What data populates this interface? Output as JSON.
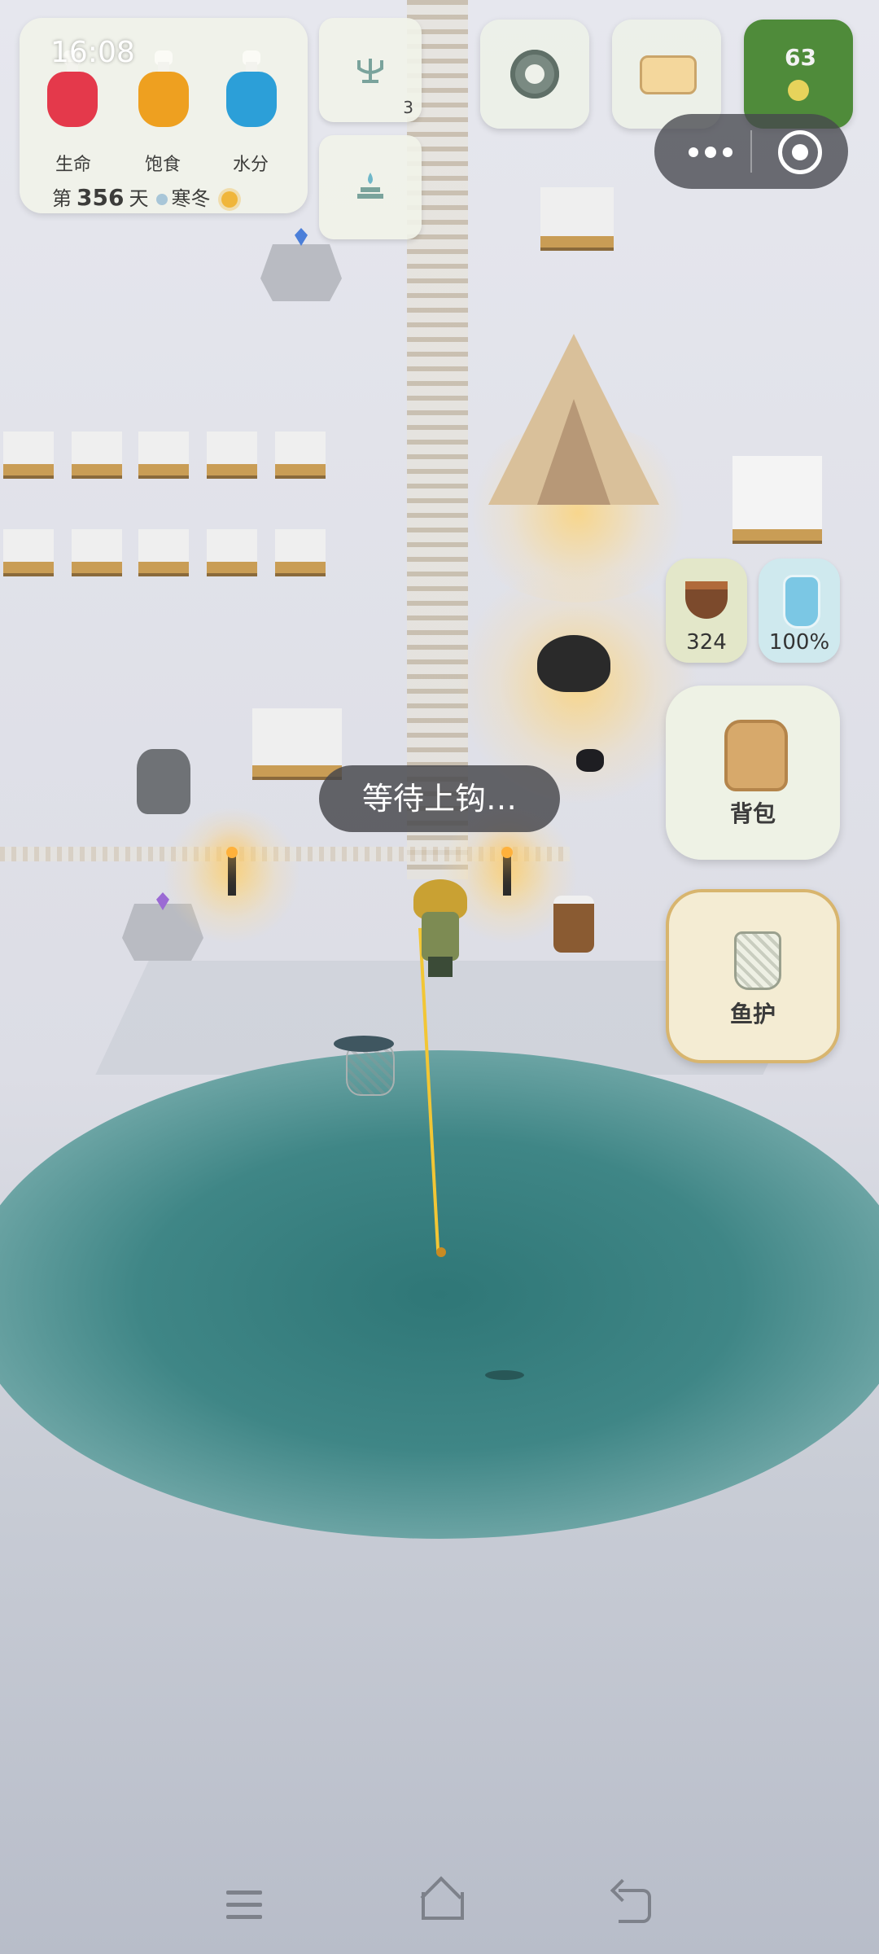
{
  "status_bar": {
    "time": "16:08"
  },
  "stats": [
    {
      "label": "生命",
      "color": "#e4394b"
    },
    {
      "label": "饱食",
      "color": "#eea020"
    },
    {
      "label": "水分",
      "color": "#2c9fd8"
    }
  ],
  "day": {
    "prefix": "第",
    "number": "356",
    "suffix": "天",
    "season": "寒冬"
  },
  "tiles": {
    "trident_count": "3"
  },
  "map": {
    "level": "63"
  },
  "resources": {
    "food": "324",
    "water": "100%"
  },
  "buttons": {
    "backpack": "背包",
    "fish_creel": "鱼护"
  },
  "toast": "等待上钩…"
}
